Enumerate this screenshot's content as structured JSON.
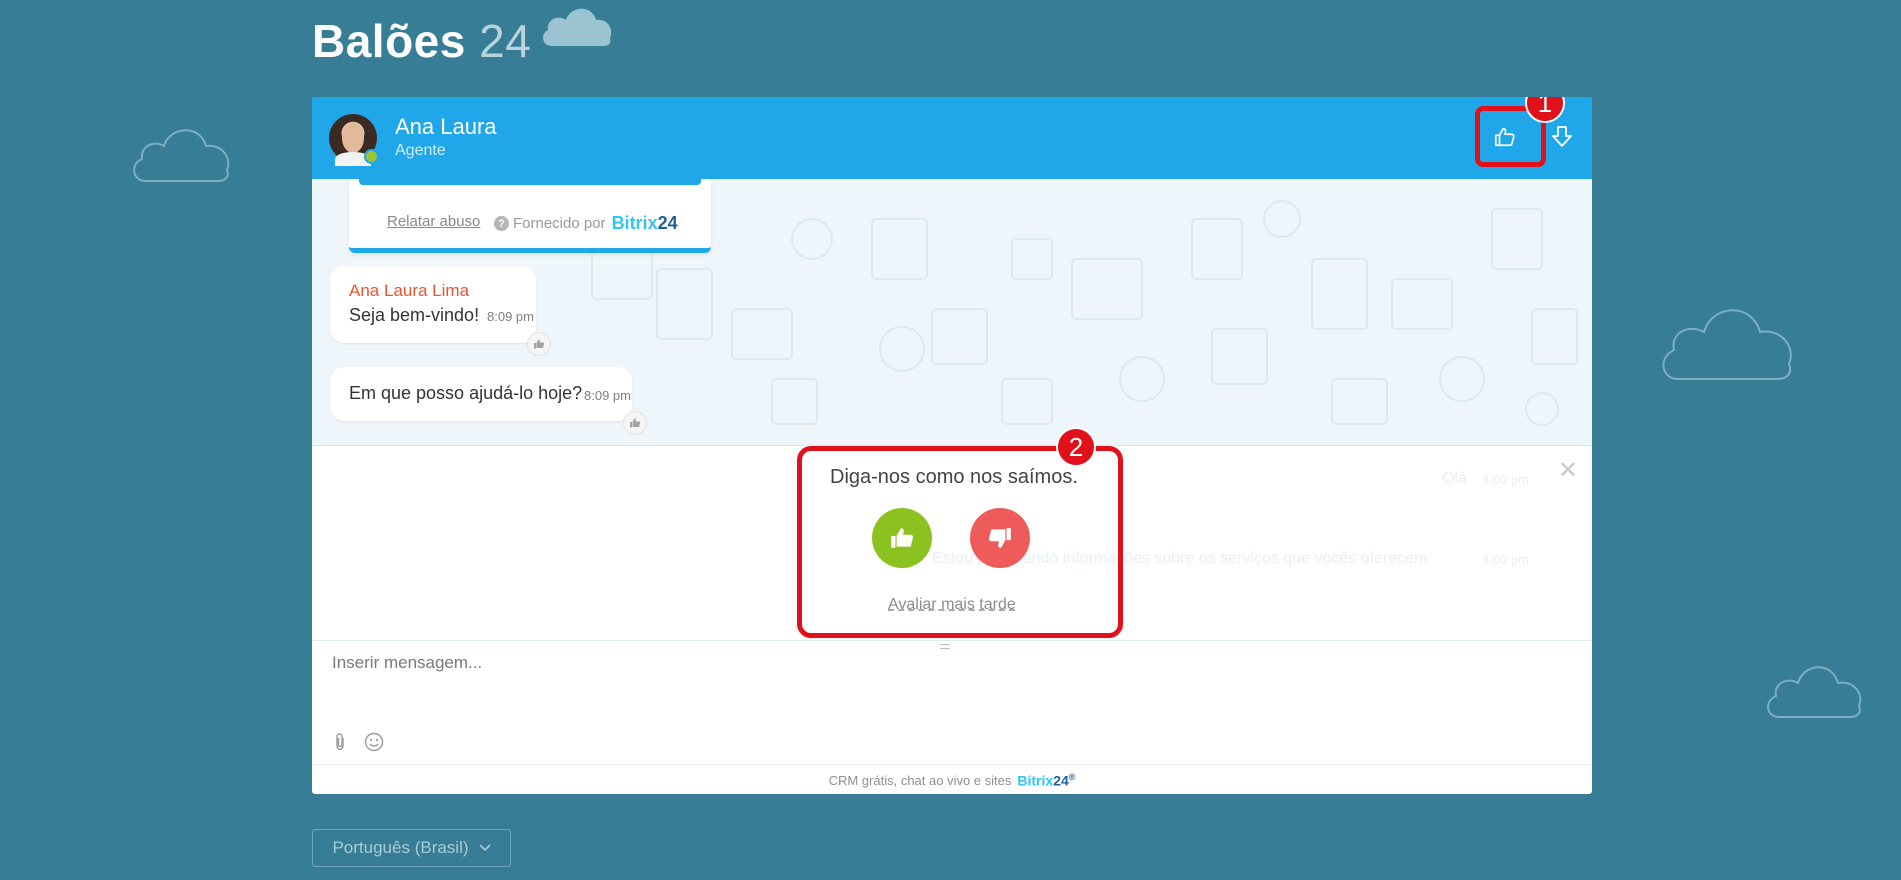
{
  "page": {
    "title": "Balões",
    "title_number": "24"
  },
  "header": {
    "agent_name": "Ana Laura",
    "agent_role": "Agente",
    "annotation_1": "1"
  },
  "footer_card": {
    "report_link": "Relatar abuso",
    "provided_by": "Fornecido por",
    "brand_bitrix": "Bitrix",
    "brand_24": "24"
  },
  "messages": [
    {
      "sender": "Ana Laura Lima",
      "text": "Seja bem-vindo!",
      "time": "8:09 pm"
    },
    {
      "sender": "",
      "text": "Em que posso ajudá-lo hoje?",
      "time": "8:09 pm"
    }
  ],
  "rating": {
    "annotation_2": "2",
    "title": "Diga-nos como nos saímos.",
    "later_link": "Avaliar mais tarde",
    "ghost_hello": "Olá",
    "ghost_time": "4:00 pm",
    "ghost_text": "Estou procurando informações sobre os serviços que vocês oferecem",
    "ghost_time2": "4:00 pm"
  },
  "input": {
    "placeholder": "Inserir mensagem..."
  },
  "powered": {
    "text": "CRM grátis, chat ao vivo e sites",
    "brand_bitrix": "Bitrix",
    "brand_24": "24"
  },
  "language": {
    "selected": "Português (Brasil)"
  },
  "colors": {
    "background": "#367d95",
    "header": "#1fa7ea",
    "like": "#8cc21f",
    "dislike": "#ee5b5b",
    "annotation": "#e0111a"
  },
  "icons": [
    "cloud-icon",
    "thumbs-up-icon",
    "download-icon",
    "thumbs-down-icon",
    "paperclip-icon",
    "smiley-icon",
    "chevron-down-icon",
    "close-icon",
    "question-icon"
  ]
}
